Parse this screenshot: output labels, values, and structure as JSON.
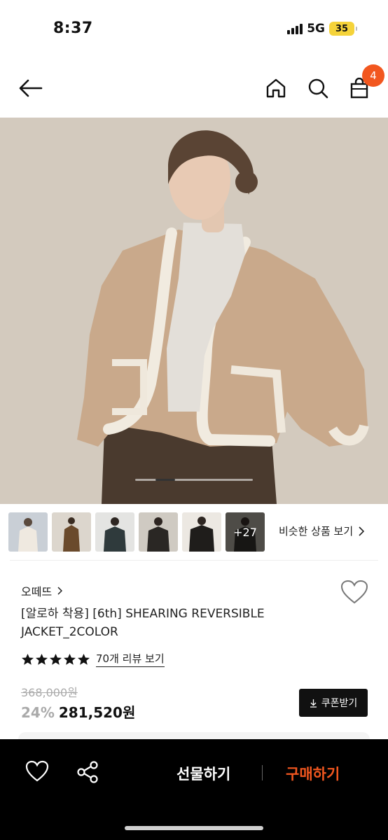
{
  "status_bar": {
    "time": "8:37",
    "network": "5G",
    "battery": "35"
  },
  "header": {
    "back_icon": "arrow-left-icon",
    "home_icon": "home-icon",
    "search_icon": "search-icon",
    "cart_icon": "shopping-bag-icon",
    "cart_count": "4",
    "badge_color": "#f2571f"
  },
  "gallery": {
    "slide_progress": 0.17,
    "thumbnails": [
      {
        "name": "thumbnail-1"
      },
      {
        "name": "thumbnail-2"
      },
      {
        "name": "thumbnail-3"
      },
      {
        "name": "thumbnail-4"
      },
      {
        "name": "thumbnail-5"
      },
      {
        "name": "thumbnail-6",
        "more": "+27"
      }
    ],
    "similar_label": "비슷한 상품 보기"
  },
  "product": {
    "brand": "오떼뜨",
    "name": "[알로하 착용] [6th] SHEARING REVERSIBLE JACKET_2COLOR",
    "rating": 5,
    "review_label": "70개 리뷰 보기",
    "original_price": "368,000원",
    "discount": "24%",
    "sale_price": "281,520원",
    "coupon_label": "쿠폰받기"
  },
  "bottom_bar": {
    "gift_label": "선물하기",
    "buy_label": "구매하기",
    "accent_color": "#f2571f"
  }
}
